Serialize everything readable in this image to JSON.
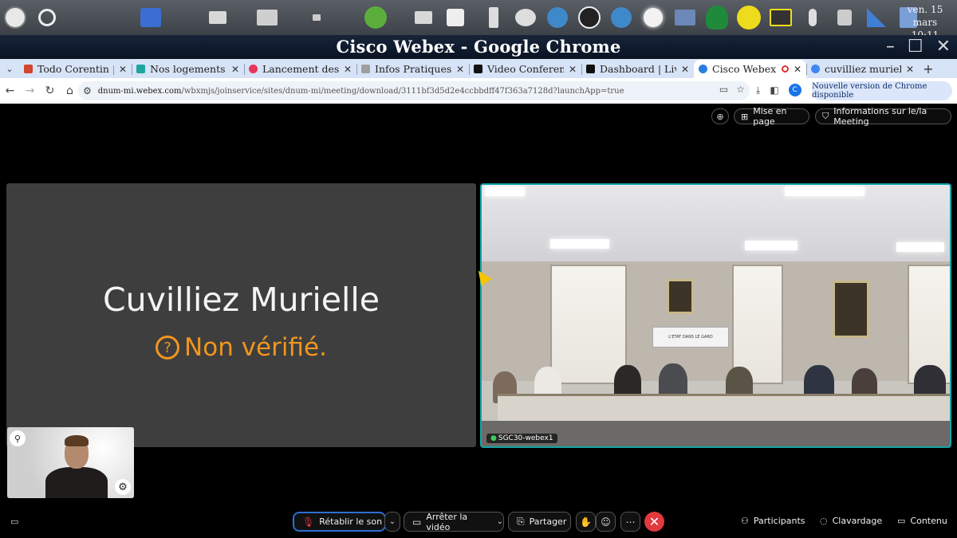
{
  "system_panel": {
    "icons": [
      "app-menu-icon",
      "magnifier-icon",
      "chart-icon",
      "printer-icon",
      "scanner-icon",
      "window-icon",
      "key-icon",
      "printer2-icon",
      "usb-icon",
      "phone-icon",
      "laptop-icon",
      "globe-icon",
      "ludo-icon",
      "globe2-icon",
      "sun-icon",
      "keyboard-icon",
      "user-icon",
      "warning-icon",
      "monitor-icon",
      "mic-icon",
      "speaker-icon",
      "signal-icon",
      "trash-icon"
    ],
    "clock_date": "ven. 15 mars",
    "clock_time": "10:11"
  },
  "window": {
    "title": "Cisco Webex - Google Chrome"
  },
  "tabs": [
    {
      "label": "Todo Corentin | T",
      "color": "#d2452e"
    },
    {
      "label": "Nos logements - ",
      "color": "#1fa4a0"
    },
    {
      "label": "Lancement des n",
      "color": "#e8345a"
    },
    {
      "label": "Infos Pratiques - ",
      "color": "#9e9e9e"
    },
    {
      "label": "Video Conferenci",
      "color": "#111111"
    },
    {
      "label": "Dashboard | Live",
      "color": "#111111"
    },
    {
      "label": "Cisco Webex",
      "color": "#2a7de1",
      "active": true
    },
    {
      "label": "cuvilliez murielle",
      "color": "#4285f4"
    }
  ],
  "addressbar": {
    "host": "dnum-mi.webex.com",
    "path": "/wbxmjs/joinservice/sites/dnum-mi/meeting/download/3111bf3d5d2e4ccbbdff47f363a7128d?launchApp=true",
    "profile_initial": "C",
    "update_label": "Nouvelle version de Chrome disponible"
  },
  "meeting": {
    "fit_label": "Mise en page",
    "info_label": "Informations sur le/la Meeting",
    "participant_name": "Cuvilliez Murielle",
    "verification_status": "Non vérifié.",
    "room_label": "SGC30-webex1",
    "banner_text": "L'ETAT DANS LE GARD"
  },
  "controls": {
    "unmute_label": "Rétablir le son",
    "video_label": "Arrêter la vidéo",
    "share_label": "Partager",
    "participants_label": "Participants",
    "chat_label": "Clavardage",
    "content_label": "Contenu"
  },
  "colors": {
    "accent_teal": "#13a6a6",
    "warning_orange": "#f0961e",
    "hangup_red": "#e0393e",
    "unmute_border": "#2d6fd3"
  }
}
